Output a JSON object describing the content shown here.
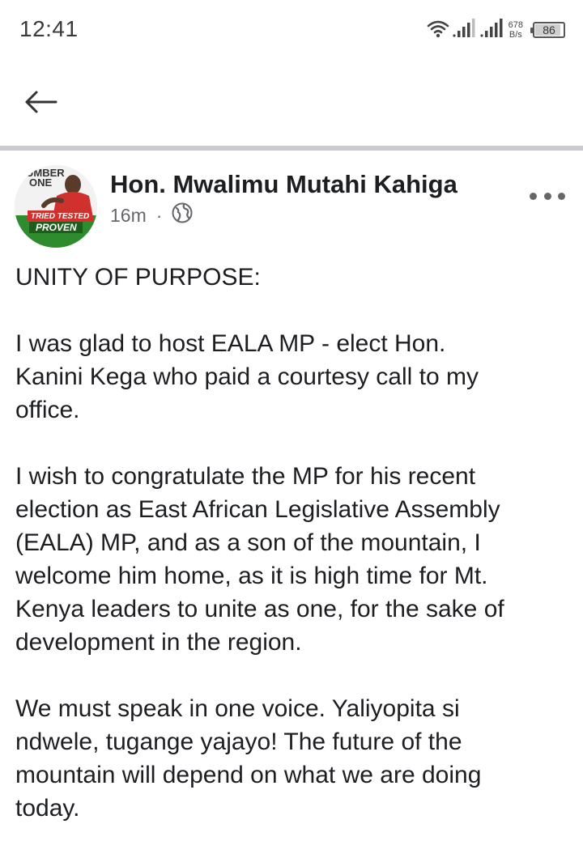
{
  "status_bar": {
    "time": "12:41",
    "net_speed_value": "678",
    "net_speed_unit": "B/s",
    "battery_level": "86",
    "icons": [
      "wifi-icon",
      "signal-icon",
      "signal-icon",
      "battery-icon"
    ]
  },
  "app_bar": {
    "back_icon": "arrow-left-icon"
  },
  "post": {
    "author": "Hon. Mwalimu Mutahi Kahiga",
    "time_ago": "16m",
    "meta_separator": "·",
    "privacy_icon": "globe-icon",
    "avatar_text": {
      "top": "UMBER",
      "top2": "ONE",
      "banner1": "TRIED TESTED",
      "banner2": "PROVEN"
    },
    "paragraphs": [
      "UNITY OF PURPOSE:",
      "I was glad to host EALA MP - elect Hon.\nKanini Kega who paid a courtesy call to my\noffice.",
      "I wish to congratulate the MP for his recent\nelection as East African Legislative Assembly\n(EALA) MP, and as a son of the mountain, I\nwelcome him home, as it is high time for Mt.\nKenya leaders to unite as one, for the sake of\ndevelopment in the region.",
      "We must speak in one voice. Yaliyopita si\nndwele, tugange yajayo! The future of the\nmountain will depend on what we are doing\ntoday."
    ]
  },
  "colors": {
    "text": "#1c1e21",
    "meta": "#65676b",
    "divider": "#c9cbcf",
    "avatar_green": "#2e8b2e",
    "avatar_red": "#d0312d"
  }
}
